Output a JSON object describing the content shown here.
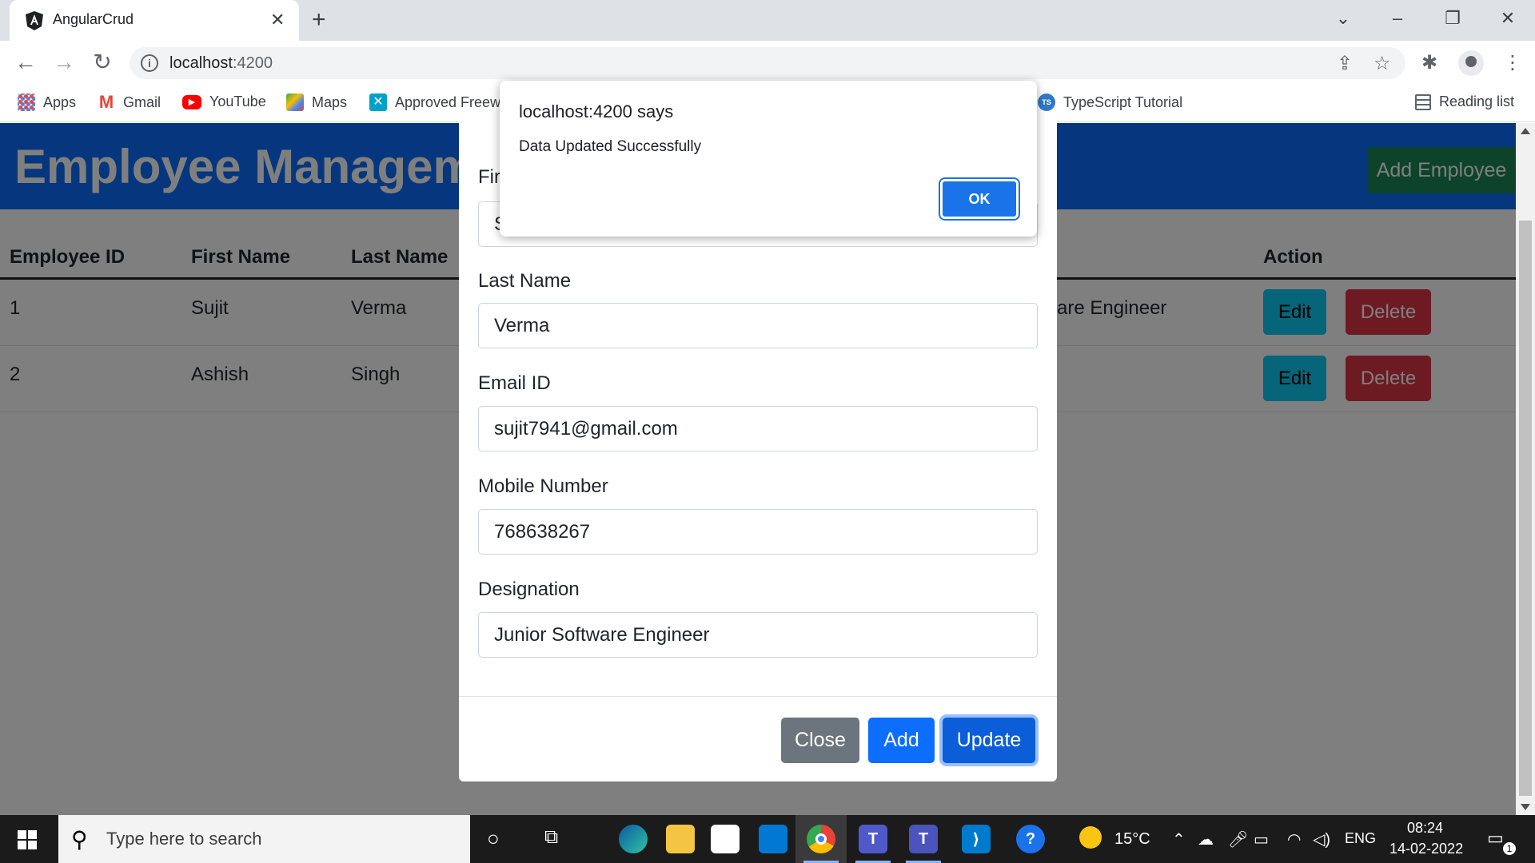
{
  "browser": {
    "tab_title": "AngularCrud",
    "url_host": "localhost",
    "url_port": ":4200",
    "bookmarks": [
      "Apps",
      "Gmail",
      "YouTube",
      "Maps",
      "Approved Freew",
      "TypeScript Tutorial"
    ],
    "reading_list": "Reading list"
  },
  "page": {
    "title": "Employee Managem",
    "add_employee_label": "Add Employee",
    "table": {
      "headers": [
        "Employee ID",
        "First Name",
        "Last Name",
        "Action"
      ],
      "rows": [
        {
          "id": "1",
          "first": "Sujit",
          "last": "Verma",
          "designation_partial": "are Engineer"
        },
        {
          "id": "2",
          "first": "Ashish",
          "last": "Singh",
          "designation_partial": ""
        }
      ],
      "edit_label": "Edit",
      "delete_label": "Delete"
    }
  },
  "modal": {
    "first_name_label_partial": "Fir",
    "first_name_value_partial": "S",
    "last_name_label": "Last Name",
    "last_name_value": "Verma",
    "email_label": "Email ID",
    "email_value": "sujit7941@gmail.com",
    "mobile_label": "Mobile Number",
    "mobile_value": "768638267",
    "designation_label": "Designation",
    "designation_value": "Junior Software Engineer",
    "close_label": "Close",
    "add_label": "Add",
    "update_label": "Update"
  },
  "alert": {
    "title": "localhost:4200 says",
    "message": "Data Updated Successfully",
    "ok_label": "OK"
  },
  "taskbar": {
    "search_placeholder": "Type here to search",
    "temperature": "15°C",
    "language": "ENG",
    "time": "08:24",
    "date": "14-02-2022",
    "notification_count": "1"
  },
  "colors": {
    "primary": "#0d6efd",
    "success": "#198754",
    "info": "#0dcaf0",
    "danger": "#dc3545",
    "secondary": "#6c757d",
    "chrome_blue": "#1a73e8"
  }
}
